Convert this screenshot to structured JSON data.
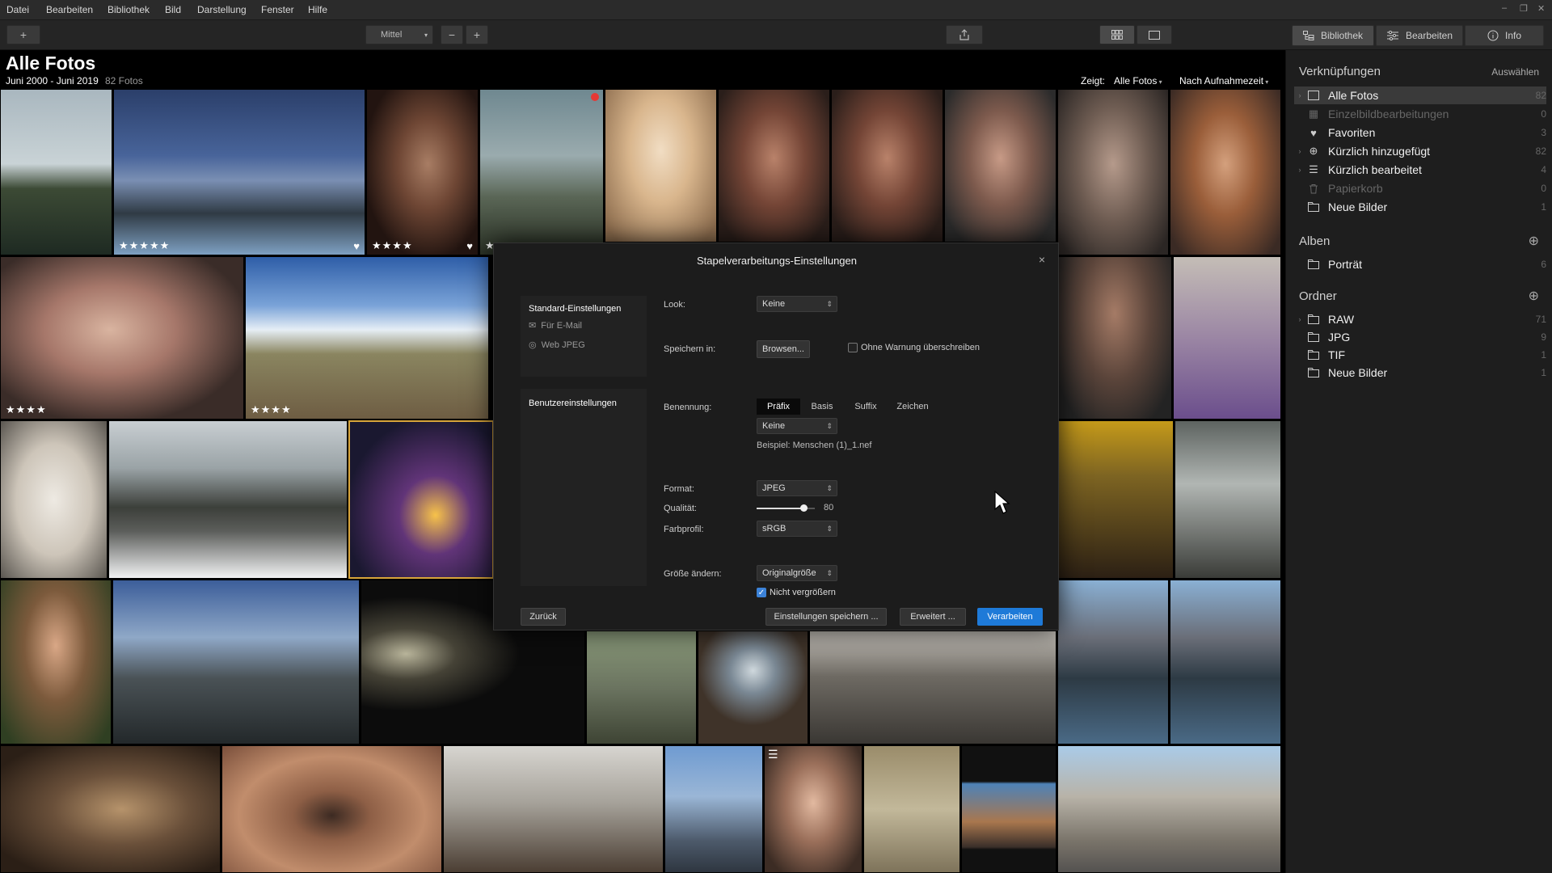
{
  "menubar": {
    "items": [
      "Datei",
      "Bearbeiten",
      "Bibliothek",
      "Bild",
      "Darstellung",
      "Fenster",
      "Hilfe"
    ],
    "window_controls": [
      "–",
      "❐",
      "✕"
    ]
  },
  "toolbar": {
    "add_label": "+",
    "size_select": "Mittel",
    "zoom_out": "−",
    "zoom_in": "+",
    "tabs": {
      "library": "Bibliothek",
      "edit": "Bearbeiten",
      "info": "Info"
    }
  },
  "header": {
    "title": "Alle Fotos",
    "date_range": "Juni 2000 - Juni 2019",
    "count": "82 Fotos",
    "shows_label": "Zeigt:",
    "shows_value": "Alle Fotos",
    "sort_value": "Nach Aufnahmezeit"
  },
  "photos": {
    "stars5": "★★★★★",
    "stars4": "★★★★",
    "stars1": "★",
    "heart": "♥"
  },
  "sidebar": {
    "shortcuts_title": "Verknüpfungen",
    "select_label": "Auswählen",
    "shortcuts": [
      {
        "label": "Alle Fotos",
        "count": "82"
      },
      {
        "label": "Einzelbildbearbeitungen",
        "count": "0"
      },
      {
        "label": "Favoriten",
        "count": "3"
      },
      {
        "label": "Kürzlich hinzugefügt",
        "count": "82"
      },
      {
        "label": "Kürzlich bearbeitet",
        "count": "4"
      },
      {
        "label": "Papierkorb",
        "count": "0"
      },
      {
        "label": "Neue Bilder",
        "count": "1"
      }
    ],
    "albums_title": "Alben",
    "albums": [
      {
        "label": "Porträt",
        "count": "6"
      }
    ],
    "folders_title": "Ordner",
    "folders": [
      {
        "label": "RAW",
        "count": "71"
      },
      {
        "label": "JPG",
        "count": "9"
      },
      {
        "label": "TIF",
        "count": "1"
      },
      {
        "label": "Neue Bilder",
        "count": "1"
      }
    ]
  },
  "dialog": {
    "title": "Stapelverarbeitungs-Einstellungen",
    "close": "×",
    "presets_title": "Standard-Einstellungen",
    "preset_email": "Für E-Mail",
    "preset_web": "Web JPEG",
    "user_title": "Benutzereinstellungen",
    "look_label": "Look:",
    "look_value": "Keine",
    "save_label": "Speichern in:",
    "browse_label": "Browsen...",
    "overwrite_label": "Ohne Warnung überschreiben",
    "naming_label": "Benennung:",
    "naming_tabs": [
      "Präfix",
      "Basis",
      "Suffix",
      "Zeichen"
    ],
    "naming_value": "Keine",
    "example": "Beispiel: Menschen (1)_1.nef",
    "format_label": "Format:",
    "format_value": "JPEG",
    "quality_label": "Qualität:",
    "quality_value": "80",
    "quality": 80,
    "profile_label": "Farbprofil:",
    "profile_value": "sRGB",
    "resize_label": "Größe ändern:",
    "resize_value": "Originalgröße",
    "no_enlarge_label": "Nicht vergrößern",
    "back_button": "Zurück",
    "save_settings_button": "Einstellungen speichern ...",
    "advanced_button": "Erweitert ...",
    "process_button": "Verarbeiten"
  }
}
